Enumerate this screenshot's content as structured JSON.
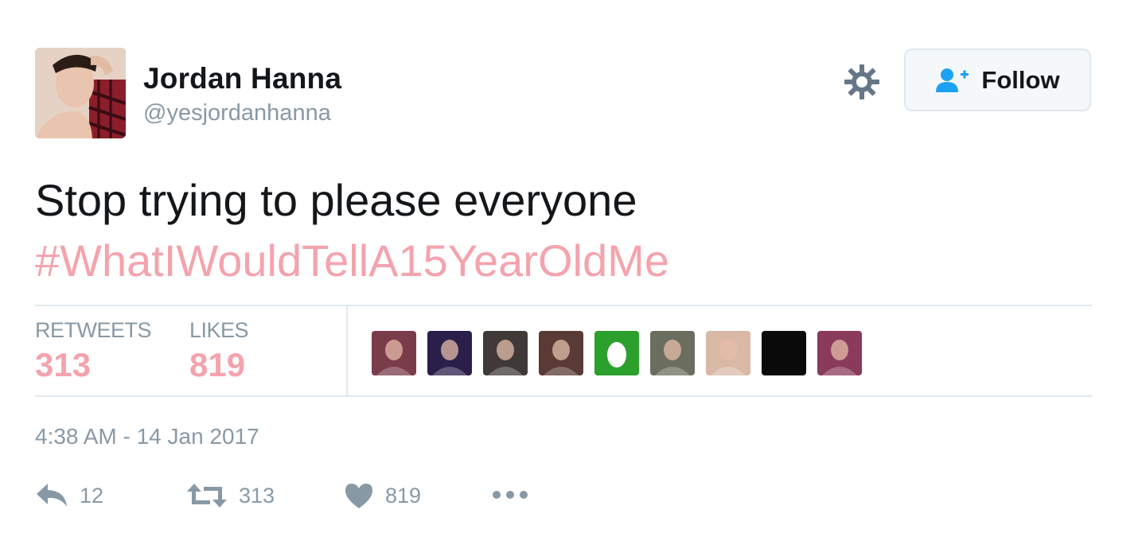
{
  "user": {
    "name": "Jordan Hanna",
    "handle": "@yesjordanhanna"
  },
  "follow_button": {
    "label": "Follow",
    "icon": "follow-person-plus-icon"
  },
  "settings": {
    "icon": "gear-icon"
  },
  "tweet": {
    "text": "Stop trying to please everyone",
    "hashtag": "#WhatIWouldTellA15YearOldMe"
  },
  "stats": {
    "retweets_label": "RETWEETS",
    "retweets_value": "313",
    "likes_label": "LIKES",
    "likes_value": "819"
  },
  "likers": [
    {
      "name": "liker-avatar-1",
      "color": "#7a3b4a"
    },
    {
      "name": "liker-avatar-2",
      "color": "#2a1f4a"
    },
    {
      "name": "liker-avatar-3",
      "color": "#3f3a38"
    },
    {
      "name": "liker-avatar-4",
      "color": "#5a3a34"
    },
    {
      "name": "liker-avatar-egg",
      "color": "#2ca02c"
    },
    {
      "name": "liker-avatar-6",
      "color": "#6b6e5e"
    },
    {
      "name": "liker-avatar-7",
      "color": "#d9b8a6"
    },
    {
      "name": "liker-avatar-8",
      "color": "#0a0a0a"
    },
    {
      "name": "liker-avatar-9",
      "color": "#8a3a5a"
    }
  ],
  "timestamp": "4:38 AM - 14 Jan 2017",
  "actions": {
    "reply_count": "12",
    "retweet_count": "313",
    "like_count": "819"
  },
  "colors": {
    "hashtag": "#f4a3ad",
    "muted": "#8899a6",
    "follow_icon": "#1da1f2",
    "border": "#e1e8ed"
  }
}
